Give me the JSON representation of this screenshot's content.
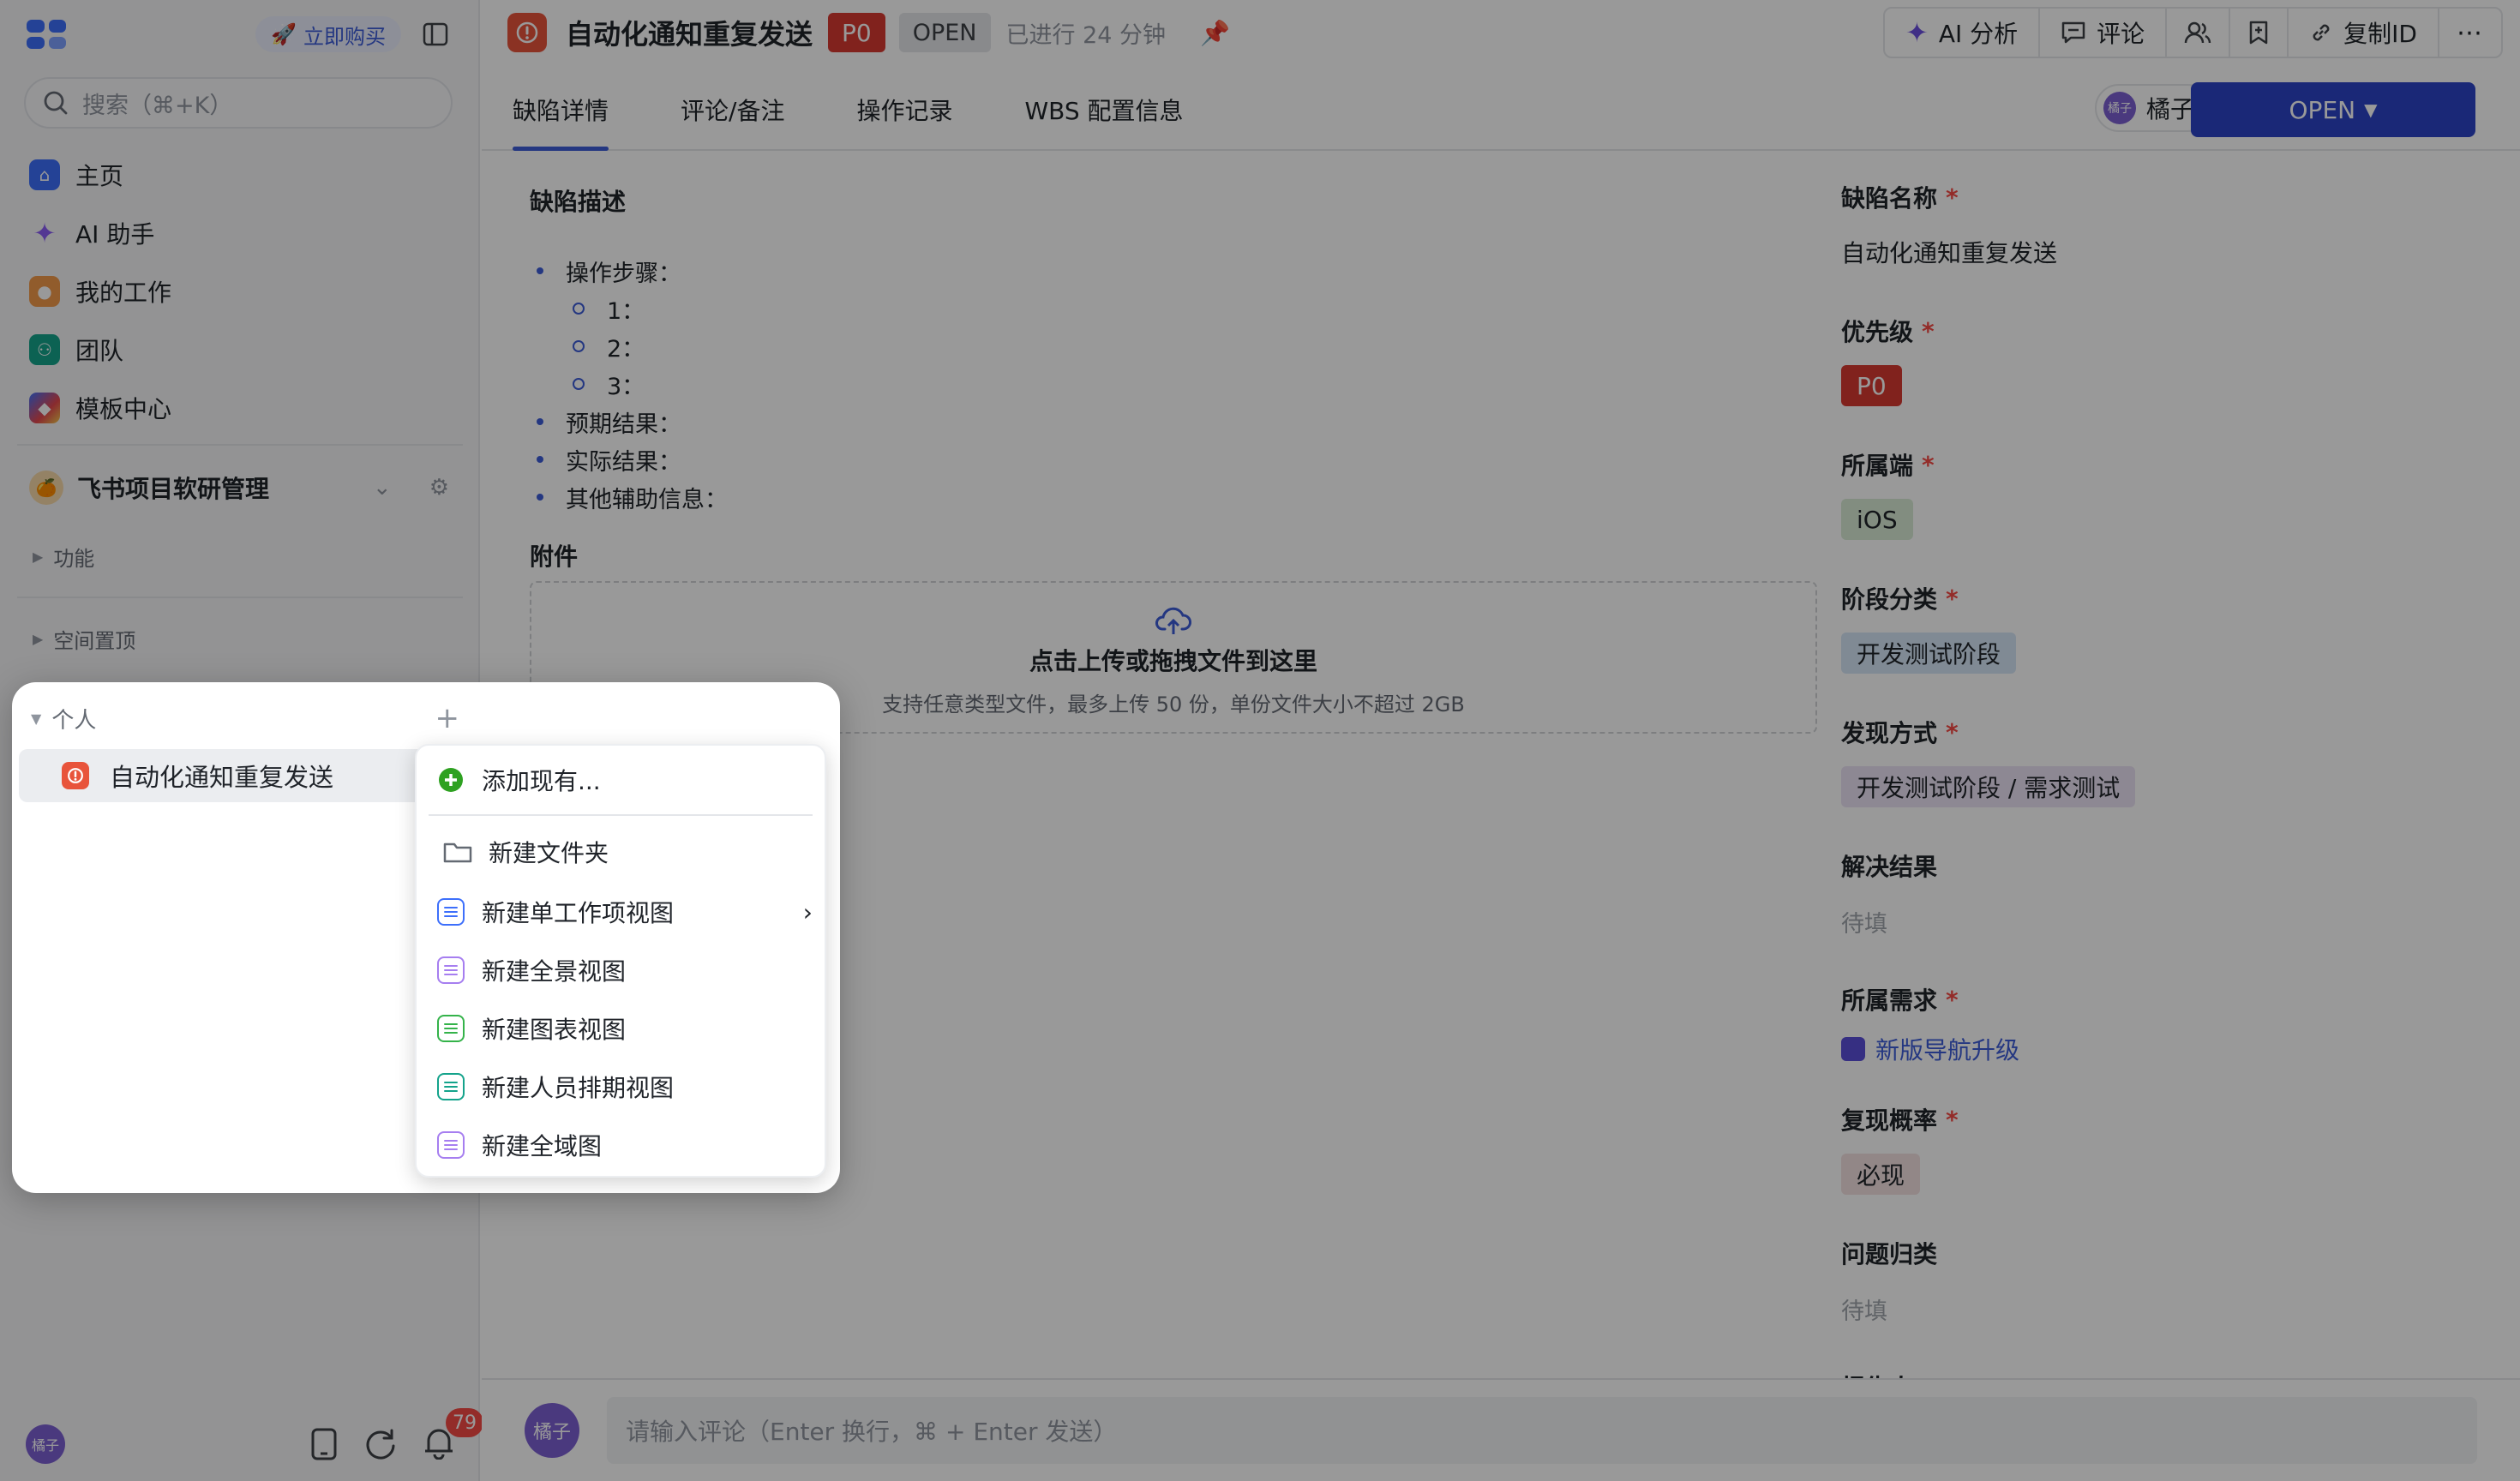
{
  "sidebar": {
    "buy_label": "立即购买",
    "search_placeholder": "搜索（⌘+K）",
    "nav": [
      {
        "label": "主页",
        "icon": "home-icon",
        "color": "#3d6ffb"
      },
      {
        "label": "AI 助手",
        "icon": "ai-sparkle-icon",
        "color": "#8a5cf6"
      },
      {
        "label": "我的工作",
        "icon": "my-work-icon",
        "color": "#f2994a"
      },
      {
        "label": "团队",
        "icon": "team-icon",
        "color": "#14a38b"
      },
      {
        "label": "模板中心",
        "icon": "template-icon",
        "color": "#e5484d"
      }
    ],
    "project_name": "飞书项目软研管理",
    "sections": {
      "features": "功能",
      "space_pinned": "空间置顶"
    },
    "notification_count": "79",
    "me_avatar": "橘子"
  },
  "header": {
    "title": "自动化通知重复发送",
    "priority": "P0",
    "status": "OPEN",
    "elapsed": "已进行 24 分钟",
    "actions": {
      "ai": "AI 分析",
      "comment": "评论",
      "copy_id": "复制ID"
    }
  },
  "tabs": [
    "缺陷详情",
    "评论/备注",
    "操作记录",
    "WBS 配置信息"
  ],
  "assignee": {
    "avatar": "橘子",
    "name": "橘子"
  },
  "status_button": "OPEN",
  "description": {
    "heading": "缺陷描述",
    "steps_label": "操作步骤：",
    "steps": [
      "1：",
      "2：",
      "3："
    ],
    "expected": "预期结果：",
    "actual": "实际结果：",
    "other": "其他辅助信息："
  },
  "attachment": {
    "heading": "附件",
    "upload_title": "点击上传或拖拽文件到这里",
    "upload_hint": "支持任意类型文件，最多上传 50 份，单份文件大小不超过 2GB"
  },
  "fields": {
    "name_label": "缺陷名称",
    "name_value": "自动化通知重复发送",
    "priority_label": "优先级",
    "priority_value": "P0",
    "platform_label": "所属端",
    "platform_value": "iOS",
    "stage_label": "阶段分类",
    "stage_value": "开发测试阶段",
    "found_label": "发现方式",
    "found_value": "开发测试阶段 / 需求测试",
    "resolution_label": "解决结果",
    "resolution_value": "待填",
    "requirement_label": "所属需求",
    "requirement_value": "新版导航升级",
    "repro_label": "复现概率",
    "repro_value": "必现",
    "category_label": "问题归类",
    "category_value": "待填",
    "reporter_label": "报告人",
    "required_mark": "*"
  },
  "comment": {
    "avatar": "橘子",
    "placeholder": "请输入评论（Enter 换行，⌘ + Enter 发送）"
  },
  "popup": {
    "section_label": "个人",
    "item_label": "自动化通知重复发送",
    "menu": {
      "add_existing": "添加现有...",
      "new_folder": "新建文件夹",
      "new_single_view": "新建单工作项视图",
      "new_panorama_view": "新建全景视图",
      "new_chart_view": "新建图表视图",
      "new_schedule_view": "新建人员排期视图",
      "new_global_view": "新建全域图"
    }
  },
  "colors": {
    "accent": "#3d5cd8",
    "danger": "#d83931",
    "primary_button": "#2c44c7"
  }
}
